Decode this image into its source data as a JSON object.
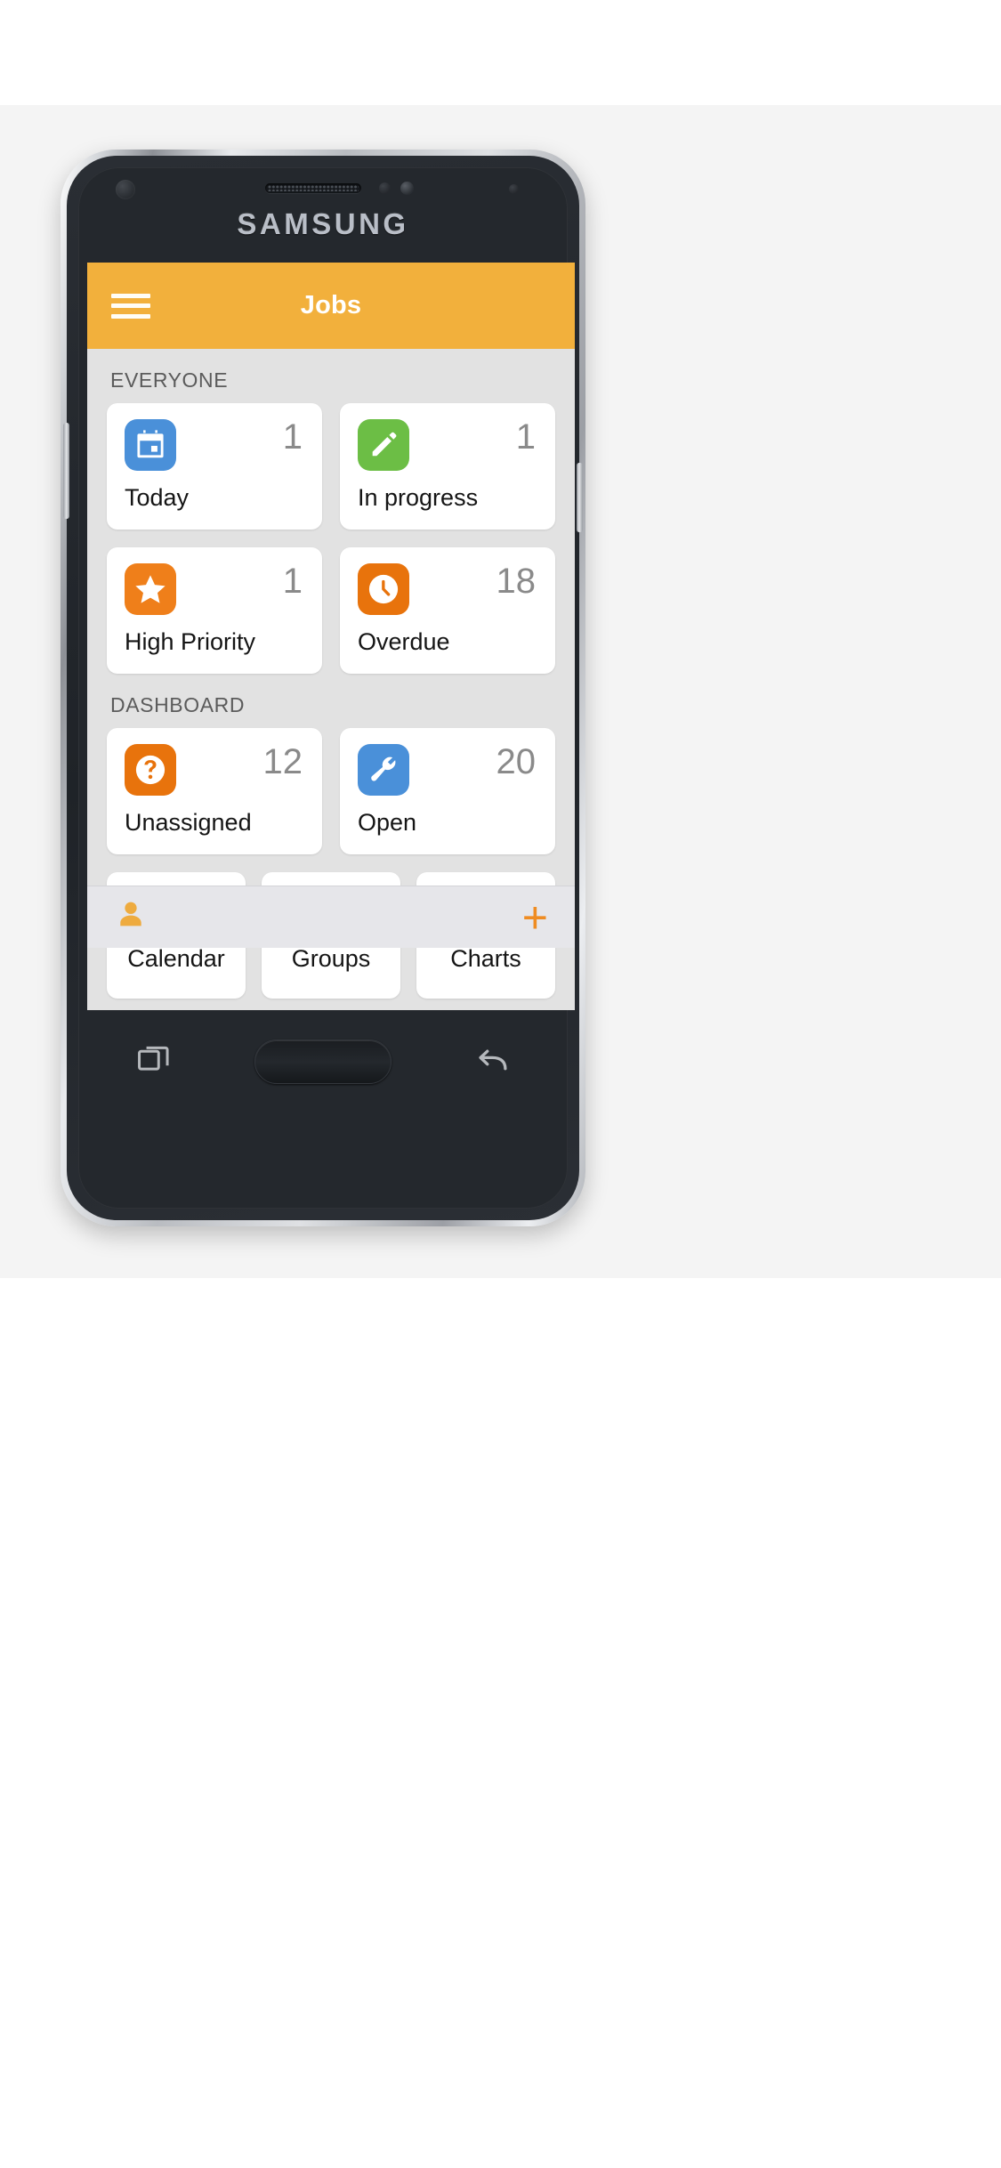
{
  "device": {
    "brand": "SAMSUNG",
    "frame_color": "#22262b",
    "rim_color": "#c9ccd1"
  },
  "appbar": {
    "title": "Jobs",
    "background": "#f2b03c",
    "menu_icon": "hamburger-icon"
  },
  "sections": [
    {
      "title": "EVERYONE",
      "cards": [
        {
          "label": "Today",
          "count": "1",
          "icon": "calendar-icon",
          "icon_bg": "#4a90d9"
        },
        {
          "label": "In progress",
          "count": "1",
          "icon": "pencil-icon",
          "icon_bg": "#6cbe45"
        },
        {
          "label": "High Priority",
          "count": "1",
          "icon": "star-icon",
          "icon_bg": "#ef7f1a"
        },
        {
          "label": "Overdue",
          "count": "18",
          "icon": "clock-icon",
          "icon_bg": "#e8730c"
        }
      ]
    },
    {
      "title": "DASHBOARD",
      "cards": [
        {
          "label": "Unassigned",
          "count": "12",
          "icon": "question-mark-icon",
          "icon_bg": "#e8730c"
        },
        {
          "label": "Open",
          "count": "20",
          "icon": "wrench-icon",
          "icon_bg": "#4a90d9"
        }
      ],
      "tiles": [
        {
          "label": "Calendar",
          "icon": "calendar-outline-icon",
          "icon_color": "#646464"
        },
        {
          "label": "Groups",
          "icon": "folder-icon",
          "icon_color": "#646464"
        },
        {
          "label": "Charts",
          "icon": "bar-chart-icon",
          "icon_color": "#646464"
        }
      ]
    }
  ],
  "bottombar": {
    "person_icon": "person-icon",
    "person_color": "#eeab3f",
    "add_label": "+",
    "add_color": "#ef8c22"
  },
  "navbar": {
    "recents_icon": "recents-icon",
    "home_button": "home-button",
    "back_icon": "back-icon"
  }
}
